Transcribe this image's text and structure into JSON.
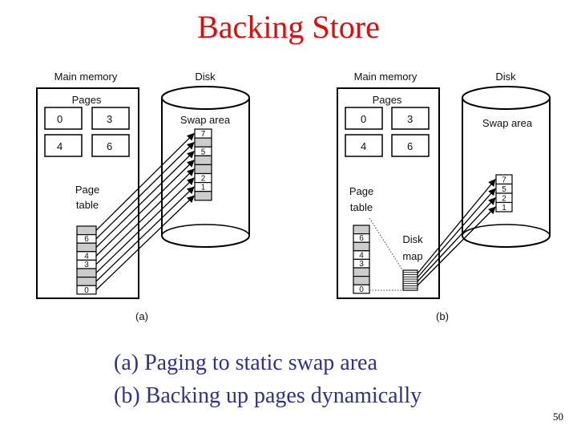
{
  "slide": {
    "title": "Backing Store",
    "captions": [
      "(a) Paging to static swap area",
      "(b) Backing up pages dynamically"
    ],
    "slide_number": "50",
    "colors": {
      "title": "#e00b0b",
      "caption": "#2e3192",
      "empty_slot": "#cccccc"
    }
  },
  "diagram_a": {
    "label": "(a)",
    "main_memory_label": "Main memory",
    "disk_label": "Disk",
    "pages_label": "Pages",
    "pages": [
      "0",
      "3",
      "4",
      "6"
    ],
    "page_table_label_1": "Page",
    "page_table_label_2": "table",
    "page_table": [
      "",
      "6",
      "",
      "4",
      "3",
      "",
      "",
      "0"
    ],
    "swap_area_label": "Swap area",
    "swap_slots": [
      "7",
      "",
      "5",
      "",
      "",
      "2",
      "1",
      ""
    ]
  },
  "diagram_b": {
    "label": "(b)",
    "main_memory_label": "Main memory",
    "disk_label": "Disk",
    "pages_label": "Pages",
    "pages": [
      "0",
      "3",
      "4",
      "6"
    ],
    "page_table_label_1": "Page",
    "page_table_label_2": "table",
    "page_table": [
      "",
      "6",
      "",
      "4",
      "3",
      "",
      "",
      "0"
    ],
    "disk_map_label_1": "Disk",
    "disk_map_label_2": "map",
    "swap_area_label": "Swap area",
    "swap_slots": [
      "7",
      "5",
      "2",
      "1"
    ]
  }
}
